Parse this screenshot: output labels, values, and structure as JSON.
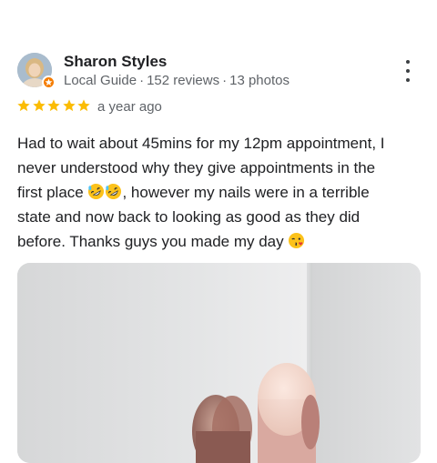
{
  "reviewer": {
    "name": "Sharon Styles",
    "role": "Local Guide",
    "reviews": "152 reviews",
    "photos": "13 photos",
    "separator": "·"
  },
  "rating": {
    "stars": 5,
    "max": 5,
    "date": "a year ago",
    "star_color": "#fbbc04"
  },
  "review": {
    "line1": "Had to wait about 45mins for my 12pm appointment, I",
    "line2": "never understood why they give appointments in the",
    "line3_start": "first place ",
    "line3_emojis": [
      "rolling-on-the-floor-laughing",
      "rolling-on-the-floor-laughing"
    ],
    "line3_end": ", however my nails were in a terrible",
    "line4": "state and now back to looking as good as they did",
    "line5": "before. Thanks guys you made my day ",
    "line5_emoji": "face-blowing-a-kiss"
  },
  "icons": {
    "more": "more-vert-icon",
    "badge": "local-guide-badge-icon"
  },
  "colors": {
    "text": "#202124",
    "secondary": "#5f6368",
    "badge": "#f57c00"
  }
}
